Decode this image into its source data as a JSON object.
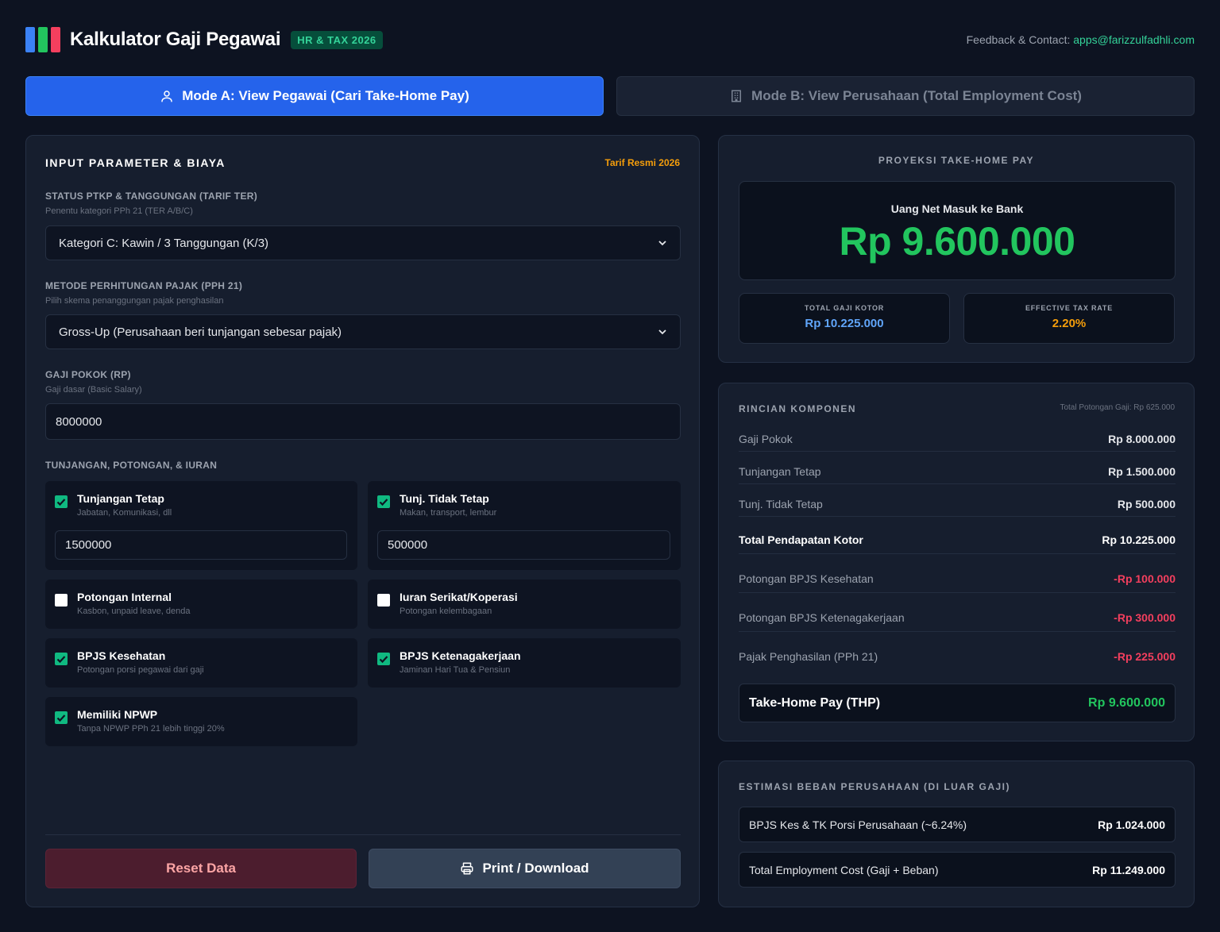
{
  "header": {
    "title": "Kalkulator Gaji Pegawai",
    "badge": "HR & TAX 2026",
    "contact_label": "Feedback & Contact:",
    "contact_email": "apps@farizzulfadhli.com",
    "logo_colors": [
      "#3b82f6",
      "#22c55e",
      "#f43f5e"
    ]
  },
  "modes": {
    "a_label": "Mode A: View Pegawai (Cari Take-Home Pay)",
    "b_label": "Mode B: View Perusahaan (Total Employment Cost)",
    "active": "a"
  },
  "input": {
    "title": "INPUT PARAMETER & BIAYA",
    "tarif": "Tarif Resmi 2026",
    "ptkp": {
      "label": "STATUS PTKP & TANGGUNGAN (TARIF TER)",
      "sub": "Penentu kategori PPh 21 (TER A/B/C)",
      "value": "Kategori C: Kawin / 3 Tanggungan (K/3)"
    },
    "metode": {
      "label": "METODE PERHITUNGAN PAJAK (PPH 21)",
      "sub": "Pilih skema penanggungan pajak penghasilan",
      "value": "Gross-Up (Perusahaan beri tunjangan sebesar pajak)"
    },
    "gaji": {
      "label": "GAJI POKOK (RP)",
      "sub": "Gaji dasar (Basic Salary)",
      "value": "8000000"
    },
    "tunjangan_label": "TUNJANGAN, POTONGAN, & IURAN",
    "items": [
      {
        "title": "Tunjangan Tetap",
        "sub": "Jabatan, Komunikasi, dll",
        "checked": true,
        "value": "1500000"
      },
      {
        "title": "Tunj. Tidak Tetap",
        "sub": "Makan, transport, lembur",
        "checked": true,
        "value": "500000"
      },
      {
        "title": "Potongan Internal",
        "sub": "Kasbon, unpaid leave, denda",
        "checked": false
      },
      {
        "title": "Iuran Serikat/Koperasi",
        "sub": "Potongan kelembagaan",
        "checked": false
      },
      {
        "title": "BPJS Kesehatan",
        "sub": "Potongan porsi pegawai dari gaji",
        "checked": true
      },
      {
        "title": "BPJS Ketenagakerjaan",
        "sub": "Jaminan Hari Tua & Pensiun",
        "checked": true
      },
      {
        "title": "Memiliki NPWP",
        "sub": "Tanpa NPWP PPh 21 lebih tinggi 20%",
        "checked": true
      }
    ],
    "reset_label": "Reset Data",
    "print_label": "Print / Download"
  },
  "proyeksi": {
    "title": "PROYEKSI TAKE-HOME PAY",
    "net_label": "Uang Net Masuk ke Bank",
    "net_value": "Rp 9.600.000",
    "gaji_kotor_label": "TOTAL GAJI KOTOR",
    "gaji_kotor_value": "Rp 10.225.000",
    "tax_rate_label": "EFFECTIVE TAX RATE",
    "tax_rate_value": "2.20%"
  },
  "rincian": {
    "title": "RINCIAN KOMPONEN",
    "total_potongan": "Total Potongan Gaji: Rp 625.000",
    "rows": [
      {
        "k": "Gaji Pokok",
        "v": "Rp 8.000.000"
      },
      {
        "k": "Tunjangan Tetap",
        "v": "Rp 1.500.000"
      },
      {
        "k": "Tunj. Tidak Tetap",
        "v": "Rp 500.000"
      },
      {
        "k": "Total Pendapatan Kotor",
        "v": "Rp 10.225.000"
      },
      {
        "k": "Potongan BPJS Kesehatan",
        "v": "-Rp 100.000"
      },
      {
        "k": "Potongan BPJS Ketenagakerjaan",
        "v": "-Rp 300.000"
      },
      {
        "k": "Pajak Penghasilan (PPh 21)",
        "v": "-Rp 225.000"
      }
    ],
    "thp_label": "Take-Home Pay (THP)",
    "thp_value": "Rp 9.600.000"
  },
  "beban": {
    "title": "ESTIMASI BEBAN PERUSAHAAN (DI LUAR GAJI)",
    "rows": [
      {
        "k": "BPJS Kes & TK Porsi Perusahaan (~6.24%)",
        "v": "Rp 1.024.000"
      },
      {
        "k": "Total Employment Cost (Gaji + Beban)",
        "v": "Rp 11.249.000"
      }
    ]
  },
  "colors": {
    "accent": "#2563eb",
    "positive": "#22c55e",
    "negative": "#f43f5e",
    "warning": "#f59e0b",
    "info": "#60a5fa"
  }
}
